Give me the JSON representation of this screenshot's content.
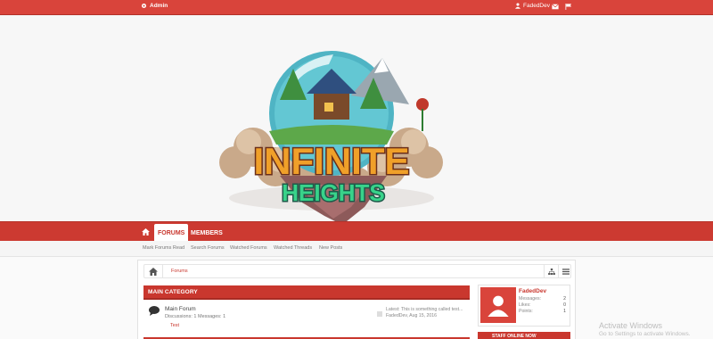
{
  "topbar": {
    "admin_label": "Admin",
    "username": "FadedDev"
  },
  "logo": {
    "line1": "INFINITE",
    "line2": "HEIGHTS"
  },
  "nav": {
    "tabs": [
      {
        "label": "FORUMS",
        "active": true
      },
      {
        "label": "MEMBERS",
        "active": false
      }
    ]
  },
  "subnav": {
    "links": [
      "Mark Forums Read",
      "Search Forums",
      "Watched Forums",
      "Watched Threads",
      "New Posts"
    ]
  },
  "breadcrumb": {
    "current": "Forums"
  },
  "category": {
    "title": "MAIN CATEGORY"
  },
  "forum": {
    "title": "Main Forum",
    "stats": "Discussions: 1 Messages: 1",
    "subforum": "Test",
    "latest": "Latest: This is something called test...",
    "latest_meta": "FadedDev, Aug 15, 2016"
  },
  "profile": {
    "name": "FadedDev",
    "stats": [
      {
        "label": "Messages:",
        "value": "2"
      },
      {
        "label": "Likes:",
        "value": "0"
      },
      {
        "label": "Points:",
        "value": "1"
      }
    ]
  },
  "sidebar_head": "STAFF ONLINE NOW",
  "watermark": {
    "line1": "Activate Windows",
    "line2": "Go to Settings to activate Windows."
  },
  "colors": {
    "accent": "#c9372e",
    "topbar": "#d9443b"
  }
}
